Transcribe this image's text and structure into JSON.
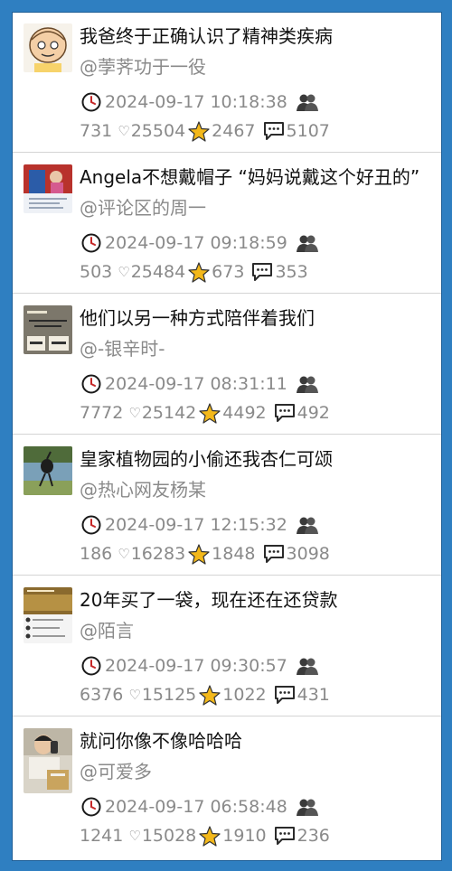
{
  "colors": {
    "background": "#2f7fc1",
    "title_text": "#111111",
    "meta_text": "#8a8a8a",
    "star": "#f3b81a",
    "comment_icon": "#2b2b2b"
  },
  "icons": {
    "time": "clock-icon",
    "author_group": "group-icon",
    "like": "heart-icon",
    "favorite": "star-icon",
    "comment": "comment-icon"
  },
  "posts": [
    {
      "title": "我爸终于正确认识了精神类疾病",
      "author": "@荸荠功于一役",
      "time": "2024-09-17 10:18:38",
      "views": "731",
      "likes": "25504",
      "stars": "2467",
      "comments": "5107"
    },
    {
      "title": "Angela不想戴帽子 “妈妈说戴这个好丑的”",
      "author": "@评论区的周一",
      "time": "2024-09-17 09:18:59",
      "views": "503",
      "likes": "25484",
      "stars": "673",
      "comments": "353"
    },
    {
      "title": "他们以另一种方式陪伴着我们",
      "author": "@-银辛时-",
      "time": "2024-09-17 08:31:11",
      "views": "7772",
      "likes": "25142",
      "stars": "4492",
      "comments": "492"
    },
    {
      "title": "皇家植物园的小偷还我杏仁可颂",
      "author": "@热心网友杨某",
      "time": "2024-09-17 12:15:32",
      "views": "186",
      "likes": "16283",
      "stars": "1848",
      "comments": "3098"
    },
    {
      "title": "20年买了一袋，现在还在还贷款",
      "author": "@陌言",
      "time": "2024-09-17 09:30:57",
      "views": "6376",
      "likes": "15125",
      "stars": "1022",
      "comments": "431"
    },
    {
      "title": "就问你像不像哈哈哈",
      "author": "@可爱多",
      "time": "2024-09-17 06:58:48",
      "views": "1241",
      "likes": "15028",
      "stars": "1910",
      "comments": "236"
    }
  ]
}
